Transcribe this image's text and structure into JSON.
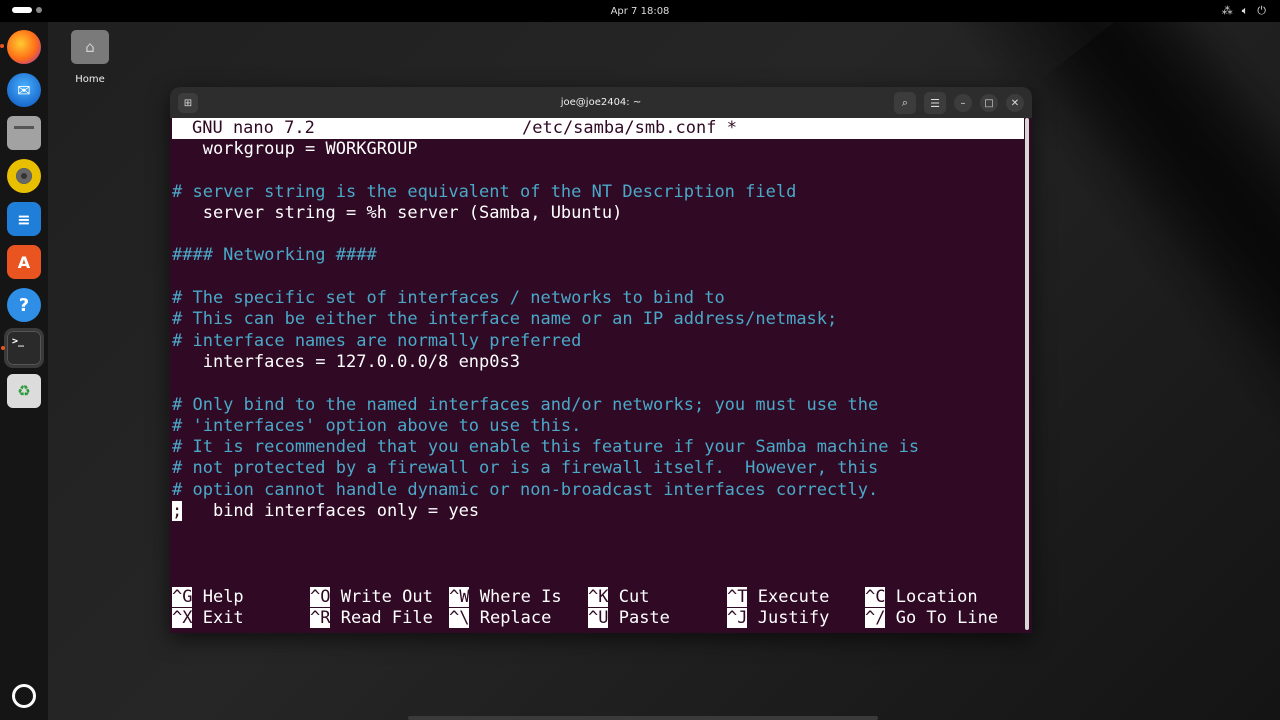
{
  "topbar": {
    "clock": "Apr 7  18:08",
    "tray_icons": [
      "network-icon",
      "volume-icon",
      "power-icon"
    ]
  },
  "desktop": {
    "home_label": "Home"
  },
  "dock": {
    "apps": [
      "Firefox",
      "Thunderbird",
      "Files",
      "Rhythmbox",
      "LibreOffice Writer",
      "App Center",
      "Help",
      "Terminal",
      "Trash"
    ]
  },
  "window": {
    "title": "joe@joe2404: ~"
  },
  "nano": {
    "version": "GNU nano 7.2",
    "file": "/etc/samba/smb.conf *",
    "lines": [
      {
        "text": "   workgroup = WORKGROUP",
        "type": "code"
      },
      {
        "text": "",
        "type": "code"
      },
      {
        "text": "# server string is the equivalent of the NT Description field",
        "type": "comment"
      },
      {
        "text": "   server string = %h server (Samba, Ubuntu)",
        "type": "code"
      },
      {
        "text": "",
        "type": "code"
      },
      {
        "text": "#### Networking ####",
        "type": "comment"
      },
      {
        "text": "",
        "type": "code"
      },
      {
        "text": "# The specific set of interfaces / networks to bind to",
        "type": "comment"
      },
      {
        "text": "# This can be either the interface name or an IP address/netmask;",
        "type": "comment"
      },
      {
        "text": "# interface names are normally preferred",
        "type": "comment"
      },
      {
        "text": "   interfaces = 127.0.0.0/8 enp0s3",
        "type": "code"
      },
      {
        "text": "",
        "type": "code"
      },
      {
        "text": "# Only bind to the named interfaces and/or networks; you must use the",
        "type": "comment"
      },
      {
        "text": "# 'interfaces' option above to use this.",
        "type": "comment"
      },
      {
        "text": "# It is recommended that you enable this feature if your Samba machine is",
        "type": "comment"
      },
      {
        "text": "# not protected by a firewall or is a firewall itself.  However, this",
        "type": "comment"
      },
      {
        "text": "# option cannot handle dynamic or non-broadcast interfaces correctly.",
        "type": "comment"
      }
    ],
    "cursor_line": {
      "cursor_char": ";",
      "rest": "   bind interfaces only = yes"
    },
    "shortcuts_row1": [
      {
        "key": "^G",
        "label": "Help"
      },
      {
        "key": "^O",
        "label": "Write Out"
      },
      {
        "key": "^W",
        "label": "Where Is"
      },
      {
        "key": "^K",
        "label": "Cut"
      },
      {
        "key": "^T",
        "label": "Execute"
      },
      {
        "key": "^C",
        "label": "Location"
      }
    ],
    "shortcuts_row2": [
      {
        "key": "^X",
        "label": "Exit"
      },
      {
        "key": "^R",
        "label": "Read File"
      },
      {
        "key": "^\\",
        "label": "Replace"
      },
      {
        "key": "^U",
        "label": "Paste"
      },
      {
        "key": "^J",
        "label": "Justify"
      },
      {
        "key": "^/",
        "label": "Go To Line"
      }
    ]
  }
}
